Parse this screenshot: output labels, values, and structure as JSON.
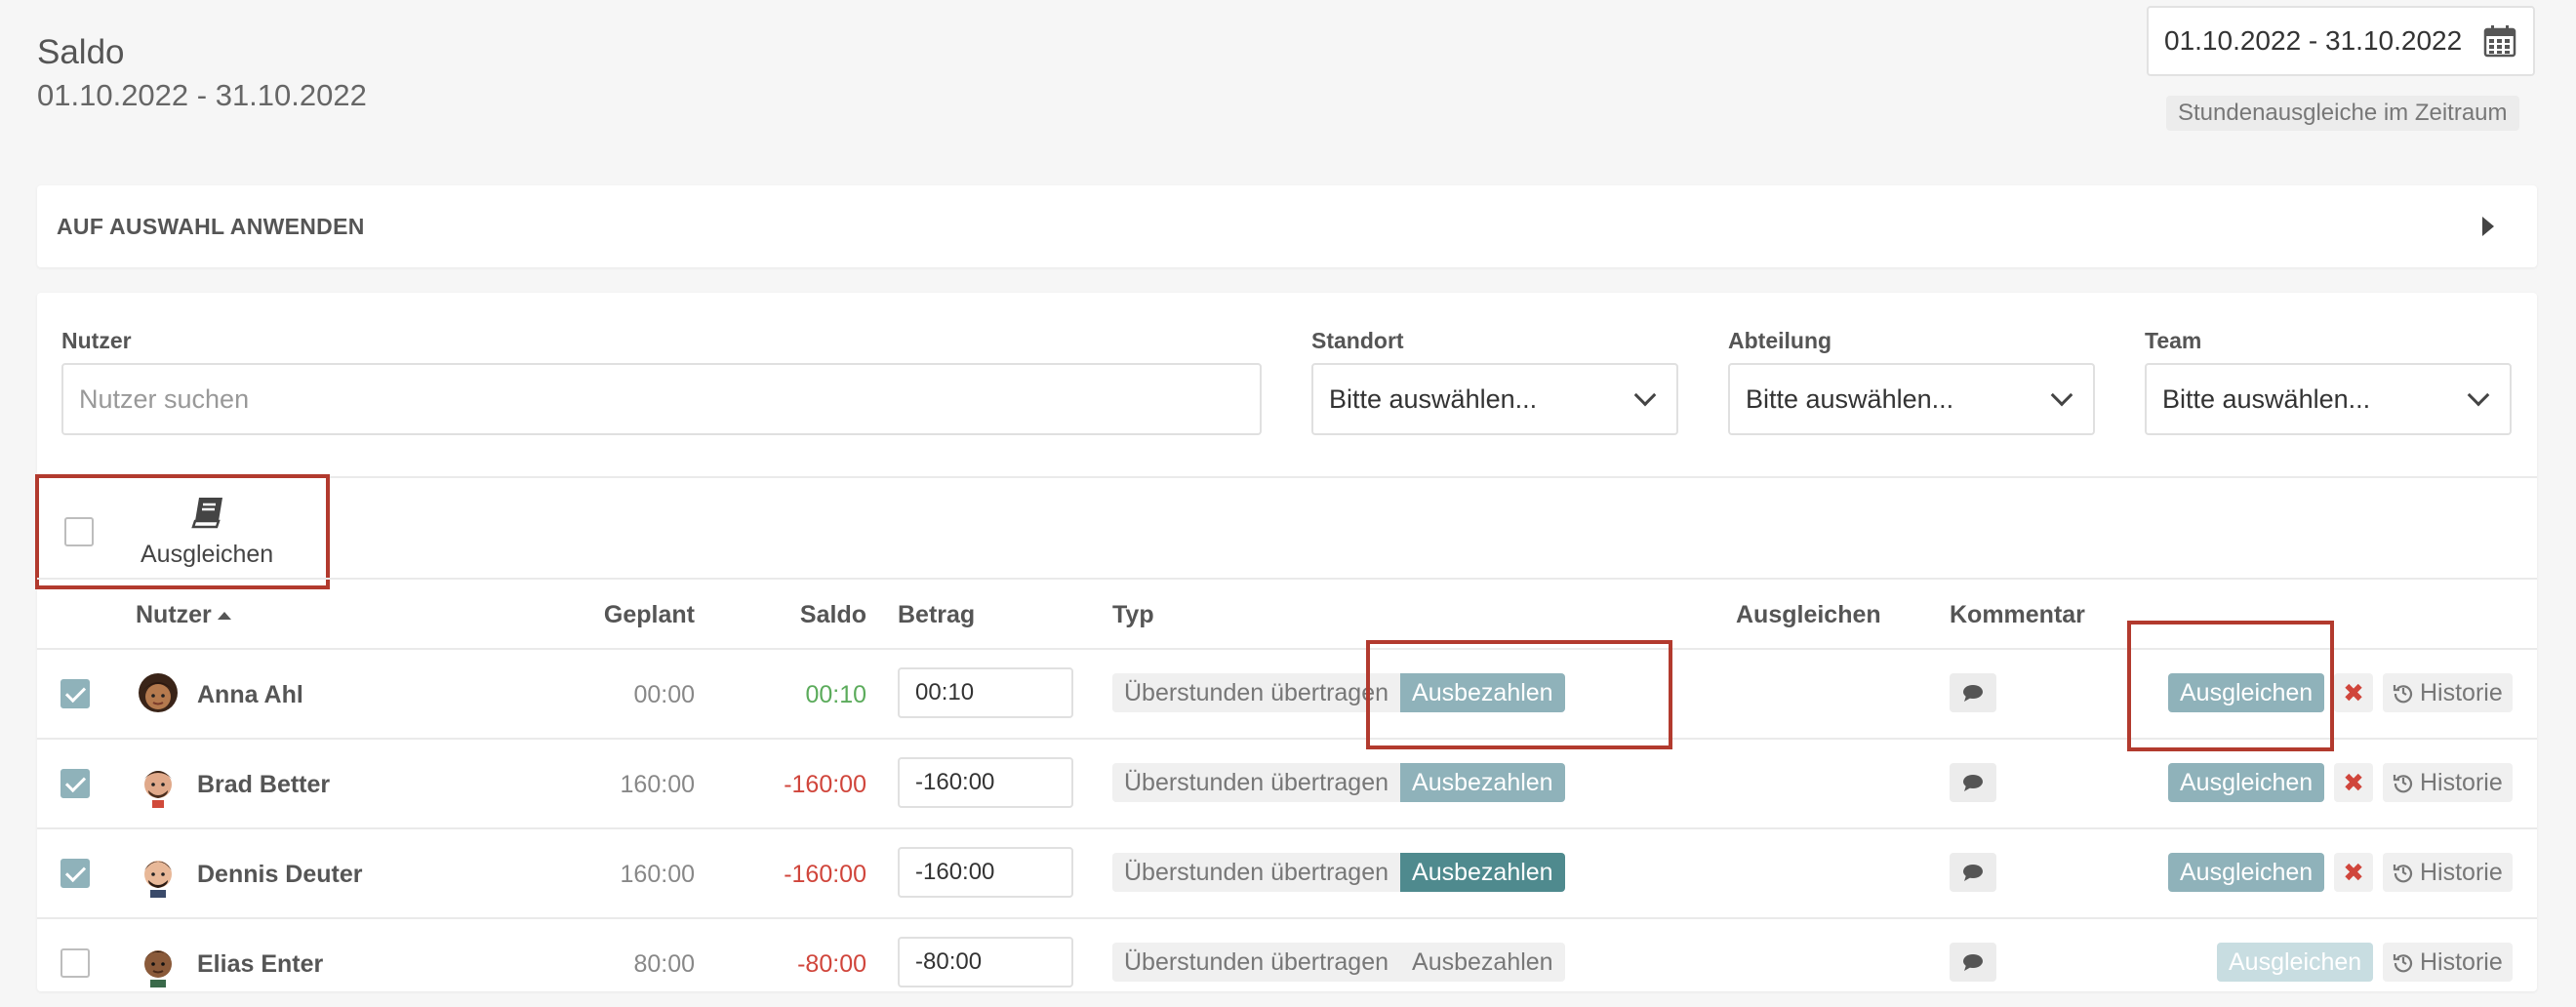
{
  "header": {
    "title": "Saldo",
    "range": "01.10.2022 - 31.10.2022",
    "date_input": "01.10.2022 - 31.10.2022",
    "badge": "Stundenausgleiche im Zeitraum"
  },
  "apply_panel": {
    "label": "AUF AUSWAHL ANWENDEN"
  },
  "filters": {
    "nutzer_label": "Nutzer",
    "nutzer_placeholder": "Nutzer suchen",
    "standort_label": "Standort",
    "standort_value": "Bitte auswählen...",
    "abteilung_label": "Abteilung",
    "abteilung_value": "Bitte auswählen...",
    "team_label": "Team",
    "team_value": "Bitte auswählen..."
  },
  "bulk": {
    "label": "Ausgleichen"
  },
  "table": {
    "headers": {
      "nutzer": "Nutzer",
      "geplant": "Geplant",
      "saldo": "Saldo",
      "betrag": "Betrag",
      "typ": "Typ",
      "ausgleichen": "Ausgleichen",
      "kommentar": "Kommentar"
    },
    "rows": [
      {
        "name": "Anna Ahl",
        "geplant": "00:00",
        "saldo": "00:10",
        "betrag": "00:10",
        "typ_a": "Überstunden übertragen",
        "typ_b": "Ausbezahlen",
        "action": "Ausgleichen",
        "remove": "✖",
        "history": "Historie"
      },
      {
        "name": "Brad Better",
        "geplant": "160:00",
        "saldo": "-160:00",
        "betrag": "-160:00",
        "typ_a": "Überstunden übertragen",
        "typ_b": "Ausbezahlen",
        "action": "Ausgleichen",
        "remove": "✖",
        "history": "Historie"
      },
      {
        "name": "Dennis Deuter",
        "geplant": "160:00",
        "saldo": "-160:00",
        "betrag": "-160:00",
        "typ_a": "Überstunden übertragen",
        "typ_b": "Ausbezahlen",
        "action": "Ausgleichen",
        "remove": "✖",
        "history": "Historie"
      },
      {
        "name": "Elias Enter",
        "geplant": "80:00",
        "saldo": "-80:00",
        "betrag": "-80:00",
        "typ_a": "Überstunden übertragen",
        "typ_b": "Ausbezahlen",
        "action": "Ausgleichen",
        "history": "Historie"
      }
    ]
  },
  "icons": {
    "calendar": "calendar-icon",
    "book": "book-icon",
    "comment": "comment-icon",
    "history": "history-icon",
    "chevron": "chevron-down-icon",
    "sort": "sort-up-icon",
    "arrow": "arrow-right-icon"
  },
  "colors": {
    "accent": "#8fb2ba",
    "accent_dark": "#4f8a8e",
    "positive": "#5bab5b",
    "negative": "#d0453b",
    "highlight": "#b23a2e"
  }
}
